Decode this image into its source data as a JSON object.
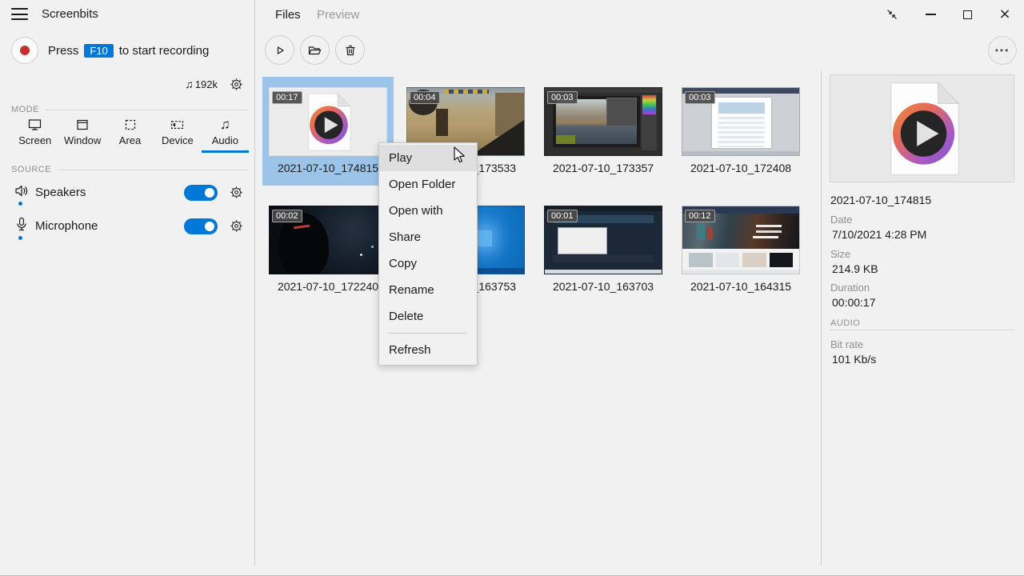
{
  "window": {
    "title": "Screenbits",
    "controls": {
      "compact": "compact-view",
      "minimize": "minimize",
      "maximize": "maximize",
      "close": "close"
    }
  },
  "sidebar": {
    "record_hint": {
      "prefix": "Press",
      "key": "F10",
      "suffix": "to start recording"
    },
    "audio_quality": "192k",
    "mode": {
      "label": "MODE",
      "tabs": [
        {
          "label": "Screen",
          "icon": "screen-icon",
          "active": false
        },
        {
          "label": "Window",
          "icon": "window-icon",
          "active": false
        },
        {
          "label": "Area",
          "icon": "area-icon",
          "active": false
        },
        {
          "label": "Device",
          "icon": "device-icon",
          "active": false
        },
        {
          "label": "Audio",
          "icon": "audio-icon",
          "active": true
        }
      ]
    },
    "source": {
      "label": "SOURCE",
      "items": [
        {
          "label": "Speakers",
          "icon": "speaker-icon",
          "enabled": true
        },
        {
          "label": "Microphone",
          "icon": "microphone-icon",
          "enabled": true
        }
      ]
    }
  },
  "main": {
    "tabs": [
      {
        "label": "Files",
        "active": true
      },
      {
        "label": "Preview",
        "active": false
      }
    ],
    "toolbar": [
      {
        "name": "play"
      },
      {
        "name": "open-folder"
      },
      {
        "name": "delete"
      }
    ],
    "more_label": "•••",
    "files": [
      {
        "name": "2021-07-10_174815",
        "duration": "00:17",
        "selected": true,
        "kind": "media-icon"
      },
      {
        "name": "2021-07-10_173533",
        "duration": "00:04",
        "selected": false,
        "kind": "shooter-game"
      },
      {
        "name": "2021-07-10_173357",
        "duration": "00:03",
        "selected": false,
        "kind": "photo-editor"
      },
      {
        "name": "2021-07-10_172408",
        "duration": "00:03",
        "selected": false,
        "kind": "document"
      },
      {
        "name": "2021-07-10_172240",
        "duration": "00:02",
        "selected": false,
        "kind": "dark-game"
      },
      {
        "name": "2021-07-10_163753",
        "duration": "",
        "selected": false,
        "kind": "desktop"
      },
      {
        "name": "2021-07-10_163703",
        "duration": "00:01",
        "selected": false,
        "kind": "storefront"
      },
      {
        "name": "2021-07-10_164315",
        "duration": "00:12",
        "selected": false,
        "kind": "website"
      }
    ]
  },
  "context_menu": {
    "items": [
      {
        "label": "Play",
        "hovered": true
      },
      {
        "label": "Open Folder",
        "hovered": false
      },
      {
        "label": "Open with",
        "hovered": false
      },
      {
        "label": "Share",
        "hovered": false
      },
      {
        "label": "Copy",
        "hovered": false
      },
      {
        "label": "Rename",
        "hovered": false
      },
      {
        "label": "Delete",
        "hovered": false
      },
      {
        "label": "Refresh",
        "hovered": false,
        "separator_before": true
      }
    ]
  },
  "details": {
    "filename": "2021-07-10_174815",
    "fields": [
      {
        "label": "Date",
        "value": "7/10/2021 4:28 PM"
      },
      {
        "label": "Size",
        "value": "214.9 KB"
      },
      {
        "label": "Duration",
        "value": "00:00:17"
      }
    ],
    "audio_section": {
      "label": "AUDIO",
      "fields": [
        {
          "label": "Bit rate",
          "value": "101 Kb/s"
        }
      ]
    }
  },
  "colors": {
    "accent": "#0078d7",
    "selection": "#9cc4e9",
    "background": "#f1f1f1"
  }
}
